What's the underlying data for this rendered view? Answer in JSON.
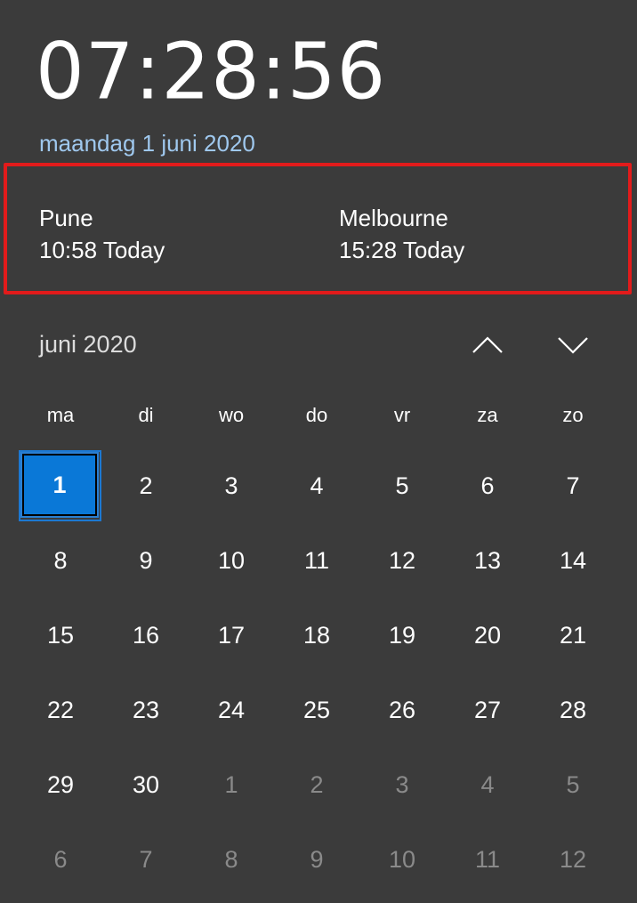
{
  "clock": {
    "time": "07:28:56"
  },
  "date_link": "maandag 1 juni 2020",
  "world_clocks": [
    {
      "city": "Pune",
      "time": "10:58 Today"
    },
    {
      "city": "Melbourne",
      "time": "15:28 Today"
    }
  ],
  "calendar": {
    "month_label": "juni 2020",
    "nav_up_icon": "chevron-up-icon",
    "nav_down_icon": "chevron-down-icon",
    "weekdays": [
      "ma",
      "di",
      "wo",
      "do",
      "vr",
      "za",
      "zo"
    ],
    "weeks": [
      [
        "1",
        "2",
        "3",
        "4",
        "5",
        "6",
        "7"
      ],
      [
        "8",
        "9",
        "10",
        "11",
        "12",
        "13",
        "14"
      ],
      [
        "15",
        "16",
        "17",
        "18",
        "19",
        "20",
        "21"
      ],
      [
        "22",
        "23",
        "24",
        "25",
        "26",
        "27",
        "28"
      ],
      [
        "29",
        "30",
        "1",
        "2",
        "3",
        "4",
        "5"
      ],
      [
        "6",
        "7",
        "8",
        "9",
        "10",
        "11",
        "12"
      ]
    ],
    "today": "1",
    "colors": {
      "background": "#3b3b3b",
      "accent": "#0a78d7",
      "highlight_border": "#e21b1b",
      "date_link": "#9fc8ee",
      "other_month_text": "#8a8a8a"
    }
  }
}
